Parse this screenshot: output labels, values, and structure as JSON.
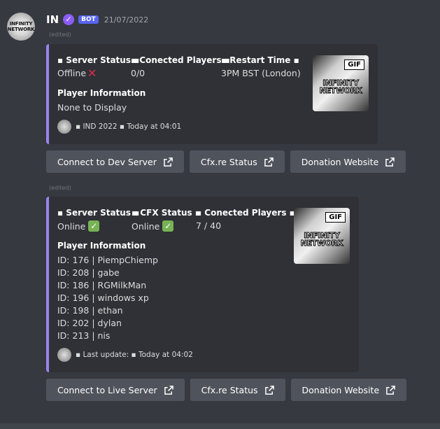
{
  "author": {
    "avatar_text": [
      "INFINITY",
      "NETWORK"
    ],
    "name": "IN",
    "verified_icon": "verified-check-icon",
    "bot_tag": "BOT",
    "timestamp": "21/07/2022"
  },
  "messages": [
    {
      "edited": "(edited)",
      "fields": [
        {
          "name": "▪ Server Status ▪",
          "value": "Offline",
          "status": "cross"
        },
        {
          "name": "▪ Conected Players ▪",
          "value": "0/0",
          "status": ""
        },
        {
          "name": "▪ Restart Time ▪",
          "value": "3PM BST (London)",
          "status": ""
        }
      ],
      "info_title": "Player Information",
      "info_lines": [
        "None to Display"
      ],
      "footer": "▪ IND 2022 ▪ Today at 04:01",
      "thumbnail": {
        "badge": "GIF",
        "line1": "INFINITY",
        "line2": "NETWORK"
      },
      "buttons": [
        "Connect to Dev Server",
        "Cfx.re Status",
        "Donation Website"
      ]
    },
    {
      "edited": "(edited)",
      "fields": [
        {
          "name": "▪ Server Status ▪",
          "value": "Online",
          "status": "check"
        },
        {
          "name": "▪ CFX Status ▪",
          "value": "Online",
          "status": "check"
        },
        {
          "name": "▪ Conected Players ▪",
          "value": "7 / 40",
          "status": ""
        }
      ],
      "info_title": "Player Information",
      "info_lines": [
        "ID: 176 | PiempChiemp",
        "ID: 208 | gabe",
        "ID: 186 | RGMilkMan",
        "ID: 196 | windows xp",
        "ID: 198 | ethan",
        "ID: 202 | dylan",
        "ID: 213 | nis"
      ],
      "footer": "▪ Last update: ▪ Today at 04:02",
      "thumbnail": {
        "badge": "GIF",
        "line1": "INFINITY",
        "line2": "NETWORK"
      },
      "buttons": [
        "Connect to Live Server",
        "Cfx.re Status",
        "Donation Website"
      ]
    }
  ],
  "colors": {
    "background": "#36393f",
    "embed": "#2f3136",
    "embed_accent": "#9b84ee",
    "button": "#4f545c",
    "bot_tag": "#5865f2"
  }
}
